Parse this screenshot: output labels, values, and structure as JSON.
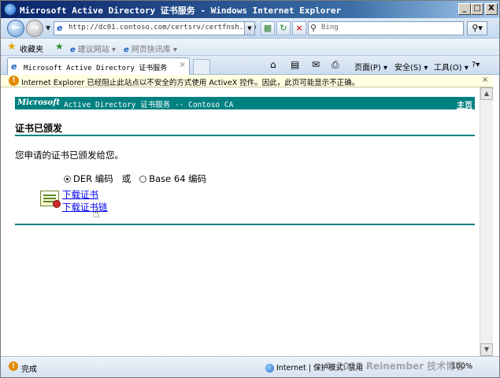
{
  "window": {
    "title": "Microsoft Active Directory 证书服务 - Windows Internet Explorer",
    "min": "_",
    "max": "□",
    "close": "X"
  },
  "address_bar": {
    "url": "http://dc01.contoso.com/certsrv/certfnsh.asp",
    "search_placeholder": "Bing"
  },
  "favorites_bar": {
    "label": "收藏夹",
    "links": [
      "建议网站 ▾",
      "网页快讯库 ▾"
    ]
  },
  "tab": {
    "title": "Microsoft Active Directory 证书服务"
  },
  "command_bar": {
    "page": "页面(P) ▾",
    "safety": "安全(S) ▾",
    "tools": "工具(O) ▾",
    "help": "?▾"
  },
  "info_bar": {
    "text": "Internet Explorer 已经阻止此站点以不安全的方式使用 ActiveX 控件。因此，此页可能显示不正确。",
    "close": "×"
  },
  "page": {
    "header_brand": "Microsoft",
    "header_rest": "Active Directory 证书服务  --  Contoso CA",
    "home_link": "主页",
    "title": "证书已颁发",
    "message": "您申请的证书已颁发给您。",
    "encoding": {
      "der_label": "DER 编码",
      "or": "或",
      "base64_label": "Base 64 编码",
      "selected": "DER"
    },
    "links": {
      "download_cert": "下载证书",
      "download_chain": "下载证书链"
    }
  },
  "status_bar": {
    "text": "完成",
    "zone": "Internet | 保护模式: 禁用",
    "zoom": "100%"
  },
  "watermark": "© 2012 Reinember 技术博客",
  "colors": {
    "header_teal": "#008080",
    "link": "#0000ee"
  }
}
